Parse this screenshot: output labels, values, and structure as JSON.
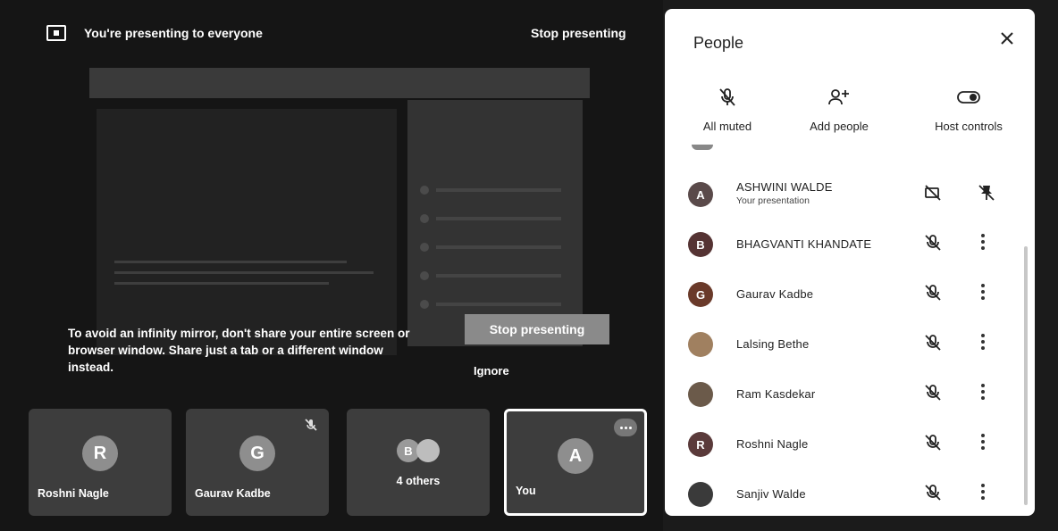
{
  "presenting_bar": {
    "message": "You're presenting to everyone",
    "stop_label": "Stop presenting"
  },
  "infinity_warning": {
    "text": "To avoid an infinity mirror, don't share your entire screen or browser window. Share just a tab or a different window instead.",
    "stop_label": "Stop presenting",
    "ignore_label": "Ignore"
  },
  "tiles": [
    {
      "initial": "R",
      "name": "Roshni Nagle"
    },
    {
      "initial": "G",
      "name": "Gaurav Kadbe"
    },
    {
      "initial": "B",
      "label": "4 others"
    },
    {
      "initial": "A",
      "name": "You"
    }
  ],
  "people_panel": {
    "title": "People",
    "actions": [
      {
        "label": "All muted",
        "icon": "mic-off-icon"
      },
      {
        "label": "Add people",
        "icon": "add-person-icon"
      },
      {
        "label": "Host controls",
        "icon": "toggle-icon"
      }
    ],
    "participants": [
      {
        "initial": "A",
        "name": "ASHWINI WALDE",
        "subtitle": "Your presentation"
      },
      {
        "initial": "B",
        "name": "BHAGVANTI KHANDATE"
      },
      {
        "initial": "G",
        "name": "Gaurav Kadbe"
      },
      {
        "initial": "",
        "name": "Lalsing Bethe"
      },
      {
        "initial": "",
        "name": "Ram Kasdekar"
      },
      {
        "initial": "R",
        "name": "Roshni Nagle"
      },
      {
        "initial": "",
        "name": "Sanjiv Walde"
      }
    ]
  }
}
